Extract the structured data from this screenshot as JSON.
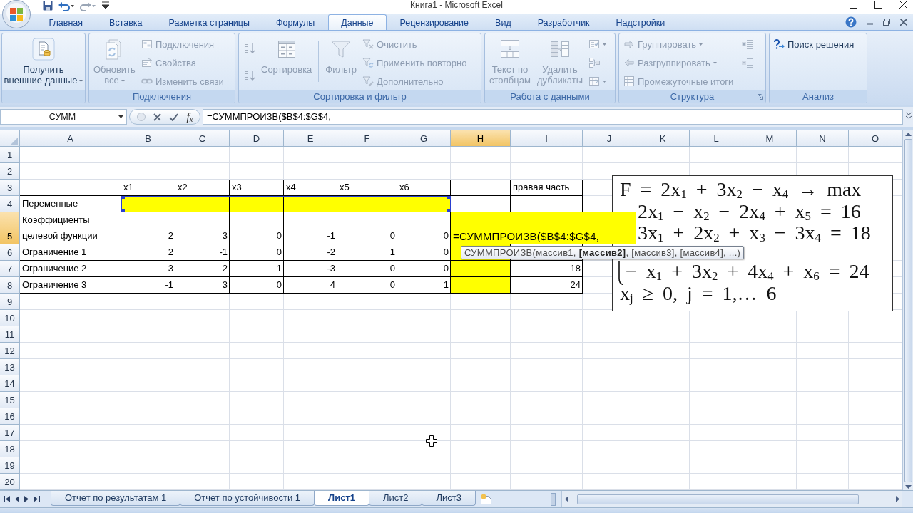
{
  "window": {
    "title": "Книга1 - Microsoft Excel"
  },
  "tabs": [
    {
      "label": "Главная",
      "selected": false
    },
    {
      "label": "Вставка",
      "selected": false
    },
    {
      "label": "Разметка страницы",
      "selected": false
    },
    {
      "label": "Формулы",
      "selected": false
    },
    {
      "label": "Данные",
      "selected": true
    },
    {
      "label": "Рецензирование",
      "selected": false
    },
    {
      "label": "Вид",
      "selected": false
    },
    {
      "label": "Разработчик",
      "selected": false
    },
    {
      "label": "Надстройки",
      "selected": false
    }
  ],
  "ribbon": {
    "groups": [
      {
        "launcher": false,
        "columns": [
          {
            "kind": "large",
            "items": [
              {
                "label": "Получить\nвнешние данные",
                "dropdown": true,
                "disabled": false
              }
            ]
          }
        ]
      },
      {
        "label": "Подключения",
        "launcher": false,
        "columns": [
          {
            "kind": "large",
            "items": [
              {
                "label": "Обновить\nвсе",
                "dropdown": true,
                "disabled": true
              }
            ]
          },
          {
            "kind": "stack",
            "items": [
              {
                "label": "Подключения",
                "dropdown": false,
                "disabled": true
              },
              {
                "label": "Свойства",
                "dropdown": false,
                "disabled": true
              },
              {
                "label": "Изменить связи",
                "dropdown": false,
                "disabled": true
              }
            ]
          }
        ]
      },
      {
        "label": "Сортировка и фильтр",
        "launcher": false,
        "columns": [
          {
            "kind": "stack",
            "items": [
              {
                "dropdown": false,
                "disabled": true
              },
              {
                "dropdown": false,
                "disabled": true
              }
            ]
          },
          {
            "kind": "large",
            "items": [
              {
                "label": "Сортировка",
                "dropdown": false,
                "disabled": true
              }
            ]
          },
          {
            "kind": "separator"
          },
          {
            "kind": "large",
            "items": [
              {
                "label": "Фильтр",
                "dropdown": false,
                "disabled": true
              }
            ]
          },
          {
            "kind": "stack",
            "items": [
              {
                "label": "Очистить",
                "dropdown": false,
                "disabled": true
              },
              {
                "label": "Применить повторно",
                "dropdown": false,
                "disabled": true
              },
              {
                "label": "Дополнительно",
                "dropdown": false,
                "disabled": true
              }
            ]
          }
        ]
      },
      {
        "label": "Работа с данными",
        "launcher": false,
        "columns": [
          {
            "kind": "large",
            "items": [
              {
                "label": "Текст по\nстолбцам",
                "dropdown": false,
                "disabled": true
              }
            ]
          },
          {
            "kind": "large",
            "items": [
              {
                "label": "Удалить\nдубликаты",
                "dropdown": false,
                "disabled": true
              }
            ]
          },
          {
            "kind": "stack",
            "items": [
              {
                "dropdown": true,
                "disabled": true
              },
              {
                "dropdown": false,
                "disabled": true
              },
              {
                "dropdown": true,
                "disabled": true
              }
            ]
          }
        ]
      },
      {
        "label": "Структура",
        "launcher": true,
        "columns": [
          {
            "kind": "stack",
            "items": [
              {
                "label": "Группировать",
                "dropdown": true,
                "disabled": true
              },
              {
                "label": "Разгруппировать",
                "dropdown": true,
                "disabled": true
              },
              {
                "label": "Промежуточные итоги",
                "dropdown": false,
                "disabled": true
              }
            ]
          },
          {
            "kind": "stack",
            "items": [
              {
                "dropdown": false,
                "disabled": true
              },
              {
                "dropdown": false,
                "disabled": true
              }
            ]
          }
        ]
      },
      {
        "label": "Анализ",
        "launcher": false,
        "columns": [
          {
            "kind": "stack",
            "items": [
              {
                "label": "Поиск решения",
                "dropdown": false,
                "disabled": false
              }
            ]
          }
        ]
      }
    ]
  },
  "formula_bar": {
    "name_box": "СУММ",
    "function_label": "f$_{x}$",
    "formula": "=СУММПРОИЗВ($B$4:$G$4,"
  },
  "sheet": {
    "columns": [
      {
        "label": "A",
        "selected": false
      },
      {
        "label": "B",
        "selected": false
      },
      {
        "label": "C",
        "selected": false
      },
      {
        "label": "D",
        "selected": false
      },
      {
        "label": "E",
        "selected": false
      },
      {
        "label": "F",
        "selected": false
      },
      {
        "label": "G",
        "selected": false
      },
      {
        "label": "H",
        "selected": true
      },
      {
        "label": "I",
        "selected": false
      },
      {
        "label": "J",
        "selected": false
      },
      {
        "label": "K",
        "selected": false
      },
      {
        "label": "L",
        "selected": false
      },
      {
        "label": "M",
        "selected": false
      },
      {
        "label": "N",
        "selected": false
      },
      {
        "label": "O",
        "selected": false
      }
    ],
    "rows": [
      {
        "label": "1",
        "selected": false
      },
      {
        "label": "2",
        "selected": false
      },
      {
        "label": "3",
        "selected": false,
        "cells": [
          {
            "kind": "empty",
            "referenced": false
          },
          {
            "kind": "text",
            "value": "x1",
            "referenced": false
          },
          {
            "kind": "text",
            "value": "x2",
            "referenced": false
          },
          {
            "kind": "text",
            "value": "x3",
            "referenced": false
          },
          {
            "kind": "text",
            "value": "x4",
            "referenced": false
          },
          {
            "kind": "text",
            "value": "x5",
            "referenced": false
          },
          {
            "kind": "text",
            "value": "x6",
            "referenced": false
          },
          {
            "kind": "empty",
            "referenced": false
          },
          {
            "kind": "text",
            "value": "правая часть",
            "referenced": false
          }
        ]
      },
      {
        "label": "4",
        "selected": false,
        "cells": [
          {
            "kind": "text",
            "value": "Переменные",
            "referenced": false
          },
          {
            "kind": "filled",
            "referenced": true
          },
          {
            "kind": "filled",
            "referenced": true
          },
          {
            "kind": "filled",
            "referenced": true
          },
          {
            "kind": "filled",
            "referenced": true
          },
          {
            "kind": "filled",
            "referenced": true
          },
          {
            "kind": "filled",
            "referenced": true
          },
          {
            "kind": "empty",
            "referenced": false
          },
          {
            "kind": "empty",
            "referenced": false
          }
        ]
      },
      {
        "label": "5",
        "selected": true,
        "cells": [
          {
            "kind": "text",
            "value": "Коэффициенты целевой функции",
            "referenced": false
          },
          {
            "kind": "number",
            "value": "2",
            "referenced": false
          },
          {
            "kind": "number",
            "value": "3",
            "referenced": false
          },
          {
            "kind": "number",
            "value": "0",
            "referenced": false
          },
          {
            "kind": "number",
            "value": "-1",
            "referenced": false
          },
          {
            "kind": "number",
            "value": "0",
            "referenced": false
          },
          {
            "kind": "number",
            "value": "0",
            "referenced": false
          },
          {
            "kind": "editing",
            "value": "=СУММПРОИЗВ($B$4:$G$4,",
            "referenced": false
          }
        ]
      },
      {
        "label": "6",
        "selected": false,
        "cells": [
          {
            "kind": "text",
            "value": "Ограничение 1",
            "referenced": false
          },
          {
            "kind": "number",
            "value": "2",
            "referenced": false
          },
          {
            "kind": "number",
            "value": "-1",
            "referenced": false
          },
          {
            "kind": "number",
            "value": "0",
            "referenced": false
          },
          {
            "kind": "number",
            "value": "-2",
            "referenced": false
          },
          {
            "kind": "number",
            "value": "1",
            "referenced": false
          },
          {
            "kind": "number",
            "value": "0",
            "referenced": false
          },
          {
            "kind": "filled",
            "referenced": false
          },
          {
            "kind": "empty",
            "referenced": false
          }
        ]
      },
      {
        "label": "7",
        "selected": false,
        "cells": [
          {
            "kind": "text",
            "value": "Ограничение 2",
            "referenced": false
          },
          {
            "kind": "number",
            "value": "3",
            "referenced": false
          },
          {
            "kind": "number",
            "value": "2",
            "referenced": false
          },
          {
            "kind": "number",
            "value": "1",
            "referenced": false
          },
          {
            "kind": "number",
            "value": "-3",
            "referenced": false
          },
          {
            "kind": "number",
            "value": "0",
            "referenced": false
          },
          {
            "kind": "number",
            "value": "0",
            "referenced": false
          },
          {
            "kind": "filled",
            "referenced": false
          },
          {
            "kind": "number",
            "value": "18",
            "referenced": false
          }
        ]
      },
      {
        "label": "8",
        "selected": false,
        "cells": [
          {
            "kind": "text",
            "value": "Ограничение 3",
            "referenced": false
          },
          {
            "kind": "number",
            "value": "-1",
            "referenced": false
          },
          {
            "kind": "number",
            "value": "3",
            "referenced": false
          },
          {
            "kind": "number",
            "value": "0",
            "referenced": false
          },
          {
            "kind": "number",
            "value": "4",
            "referenced": false
          },
          {
            "kind": "number",
            "value": "0",
            "referenced": false
          },
          {
            "kind": "number",
            "value": "1",
            "referenced": false
          },
          {
            "kind": "filled",
            "referenced": false
          },
          {
            "kind": "number",
            "value": "24",
            "referenced": false
          }
        ]
      },
      {
        "label": "9",
        "selected": false
      },
      {
        "label": "10",
        "selected": false
      },
      {
        "label": "11",
        "selected": false
      },
      {
        "label": "12",
        "selected": false
      },
      {
        "label": "13",
        "selected": false
      },
      {
        "label": "14",
        "selected": false
      },
      {
        "label": "15",
        "selected": false
      },
      {
        "label": "16",
        "selected": false
      },
      {
        "label": "17",
        "selected": false
      },
      {
        "label": "18",
        "selected": false
      },
      {
        "label": "19",
        "selected": false
      },
      {
        "label": "20",
        "selected": false
      }
    ],
    "tooltip": "СУММПРОИЗВ(массив1, **[массив2]**, [массив3], [массив4], ...)",
    "equation": {
      "lines": [
        "F = 2x$_{1}$ + 3x$_{2}$ − x$_{4}$ → max",
        "2x$_{1}$ − x$_{2}$ − 2x$_{4}$ + x$_{5}$ = 16",
        "3x$_{1}$ + 2x$_{2}$ + x$_{3}$ − 3x$_{4}$ = 18",
        "− x$_{1}$ + 3x$_{2}$ + 4x$_{4}$ + x$_{6}$ = 24",
        "x$_{j}$ ≥ 0, j = 1,… 6"
      ]
    }
  },
  "sheet_tabs": [
    {
      "label": "Отчет по результатам 1",
      "selected": false
    },
    {
      "label": "Отчет по устойчивости 1",
      "selected": false
    },
    {
      "label": "Лист1",
      "selected": true
    },
    {
      "label": "Лист2",
      "selected": false
    },
    {
      "label": "Лист3",
      "selected": false
    }
  ]
}
